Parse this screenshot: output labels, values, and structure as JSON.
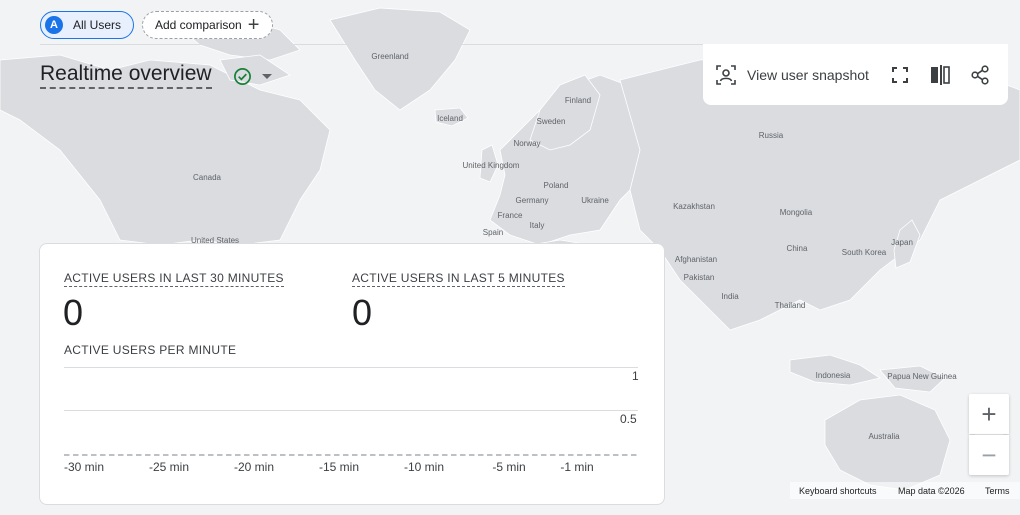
{
  "header": {
    "comparison_chip": {
      "avatar_letter": "A",
      "label": "All Users"
    },
    "add_comparison": {
      "label": "Add comparison",
      "icon": "plus-icon"
    },
    "title": "Realtime overview",
    "status_icon": "check-circle-icon",
    "menu_icon": "caret-down-icon"
  },
  "toolbar": {
    "snapshot_label": "View user snapshot",
    "snapshot_icon": "user-snapshot-icon",
    "fullscreen_icon": "fullscreen-icon",
    "compare_icon": "compare-columns-icon",
    "share_icon": "share-icon"
  },
  "card": {
    "metric_30": {
      "label": "ACTIVE USERS IN LAST 30 MINUTES",
      "value": "0"
    },
    "metric_5": {
      "label": "ACTIVE USERS IN LAST 5 MINUTES",
      "value": "0"
    },
    "chart_title": "ACTIVE USERS PER MINUTE",
    "y_ticks": [
      "1",
      "0.5"
    ],
    "x_ticks": [
      "-30 min",
      "-25 min",
      "-20 min",
      "-15 min",
      "-10 min",
      "-5 min",
      "-1 min"
    ]
  },
  "chart_data": {
    "type": "bar",
    "categories": [
      "-30 min",
      "-25 min",
      "-20 min",
      "-15 min",
      "-10 min",
      "-5 min",
      "-1 min"
    ],
    "values": [
      0,
      0,
      0,
      0,
      0,
      0,
      0
    ],
    "title": "ACTIVE USERS PER MINUTE",
    "xlabel": "",
    "ylabel": "",
    "ylim": [
      0,
      1
    ],
    "grid": true
  },
  "map": {
    "labels": [
      "Greenland",
      "Iceland",
      "Finland",
      "Sweden",
      "Norway",
      "Russia",
      "United Kingdom",
      "Poland",
      "Germany",
      "Ukraine",
      "France",
      "Italy",
      "Spain",
      "Kazakhstan",
      "Mongolia",
      "Canada",
      "United States",
      "China",
      "South Korea",
      "Japan",
      "Afghanistan",
      "Pakistan",
      "India",
      "Thailand",
      "Indonesia",
      "Papua New Guinea",
      "Australia"
    ],
    "zoom_in": "+",
    "zoom_out": "−",
    "footer": {
      "shortcuts": "Keyboard shortcuts",
      "map_data": "Map data ©2026",
      "terms": "Terms"
    }
  },
  "colors": {
    "accent": "#1a73e8",
    "success": "#188038",
    "land": "#dadce0",
    "water": "#f1f3f4"
  }
}
